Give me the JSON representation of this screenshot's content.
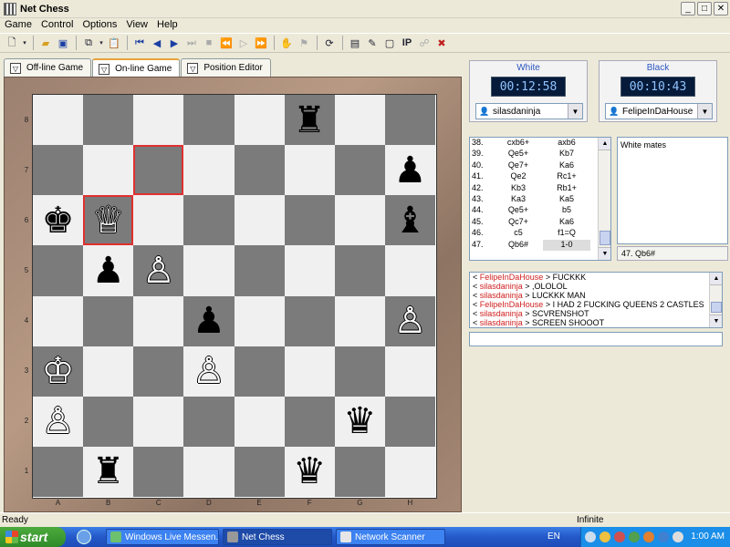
{
  "window": {
    "title": "Net Chess",
    "minimize": "_",
    "maximize": "□",
    "close": "✕"
  },
  "menu": [
    "Game",
    "Control",
    "Options",
    "View",
    "Help"
  ],
  "tabs": [
    {
      "label": "Off-line Game",
      "active": false
    },
    {
      "label": "On-line Game",
      "active": true
    },
    {
      "label": "Position Editor",
      "active": false
    }
  ],
  "toolbar": {
    "ip_label": "IP"
  },
  "board": {
    "ranks": [
      "8",
      "7",
      "6",
      "5",
      "4",
      "3",
      "2",
      "1"
    ],
    "files": [
      "A",
      "B",
      "C",
      "D",
      "E",
      "F",
      "G",
      "H"
    ],
    "highlighted": [
      "b6",
      "c7"
    ],
    "pieces": [
      {
        "sq": "f8",
        "glyph": "♜",
        "color": "b",
        "name": "black-rook"
      },
      {
        "sq": "h7",
        "glyph": "♟",
        "color": "b",
        "name": "black-pawn"
      },
      {
        "sq": "a6",
        "glyph": "♚",
        "color": "b",
        "name": "black-king"
      },
      {
        "sq": "b6",
        "glyph": "♕",
        "color": "w",
        "name": "white-queen"
      },
      {
        "sq": "h6",
        "glyph": "♝",
        "color": "b",
        "name": "black-bishop"
      },
      {
        "sq": "b5",
        "glyph": "♟",
        "color": "b",
        "name": "black-pawn"
      },
      {
        "sq": "c5",
        "glyph": "♙",
        "color": "w",
        "name": "white-pawn"
      },
      {
        "sq": "d4",
        "glyph": "♟",
        "color": "b",
        "name": "black-pawn"
      },
      {
        "sq": "h4",
        "glyph": "♙",
        "color": "w",
        "name": "white-pawn"
      },
      {
        "sq": "a3",
        "glyph": "♔",
        "color": "w",
        "name": "white-king"
      },
      {
        "sq": "d3",
        "glyph": "♙",
        "color": "w",
        "name": "white-pawn"
      },
      {
        "sq": "a2",
        "glyph": "♙",
        "color": "w",
        "name": "white-pawn"
      },
      {
        "sq": "g2",
        "glyph": "♛",
        "color": "b",
        "name": "black-queen"
      },
      {
        "sq": "b1",
        "glyph": "♜",
        "color": "b",
        "name": "black-rook"
      },
      {
        "sq": "f1",
        "glyph": "♛",
        "color": "b",
        "name": "black-queen"
      }
    ]
  },
  "white": {
    "label": "White",
    "clock": "00:12:58",
    "player": "silasdaninja"
  },
  "black": {
    "label": "Black",
    "clock": "00:10:43",
    "player": "FelipeInDaHouse"
  },
  "moves": [
    {
      "n": "38.",
      "w": "cxb6+",
      "b": "axb6"
    },
    {
      "n": "39.",
      "w": "Qe5+",
      "b": "Kb7"
    },
    {
      "n": "40.",
      "w": "Qe7+",
      "b": "Ka6"
    },
    {
      "n": "41.",
      "w": "Qe2",
      "b": "Rc1+"
    },
    {
      "n": "42.",
      "w": "Kb3",
      "b": "Rb1+"
    },
    {
      "n": "43.",
      "w": "Ka3",
      "b": "Ka5"
    },
    {
      "n": "44.",
      "w": "Qe5+",
      "b": "b5"
    },
    {
      "n": "45.",
      "w": "Qc7+",
      "b": "Ka6"
    },
    {
      "n": "46.",
      "w": "c5",
      "b": "f1=Q"
    },
    {
      "n": "47.",
      "w": "Qb6#",
      "b": "1-0"
    }
  ],
  "comment": "White mates",
  "last_move": "47. Qb6#",
  "chat": [
    {
      "prefix": "< ",
      "name": "FelipeInDaHouse",
      "name_color": "red",
      "text": " > FUCKKK"
    },
    {
      "prefix": "< ",
      "name": "silasdaninja",
      "name_color": "red",
      "text": " > ,OLOLOL"
    },
    {
      "prefix": "< ",
      "name": "silasdaninja",
      "name_color": "red",
      "text": " > LUCKKK MAN"
    },
    {
      "prefix": "< ",
      "name": "FelipeInDaHouse",
      "name_color": "red",
      "text": " > I HAD 2 FUCKING QUEENS 2 CASTLES"
    },
    {
      "prefix": "< ",
      "name": "silasdaninja",
      "name_color": "red",
      "text": " > SCVRENSHOT"
    },
    {
      "prefix": "< ",
      "name": "silasdaninja",
      "name_color": "red",
      "text": " > SCREEN SHOOOT"
    }
  ],
  "status": {
    "left": "Ready",
    "right": "Infinite"
  },
  "taskbar": {
    "start": "start",
    "tasks": [
      "Windows Live Messen...",
      "Net Chess",
      "Network Scanner"
    ],
    "lang": "EN",
    "clock": "1:00 AM"
  }
}
